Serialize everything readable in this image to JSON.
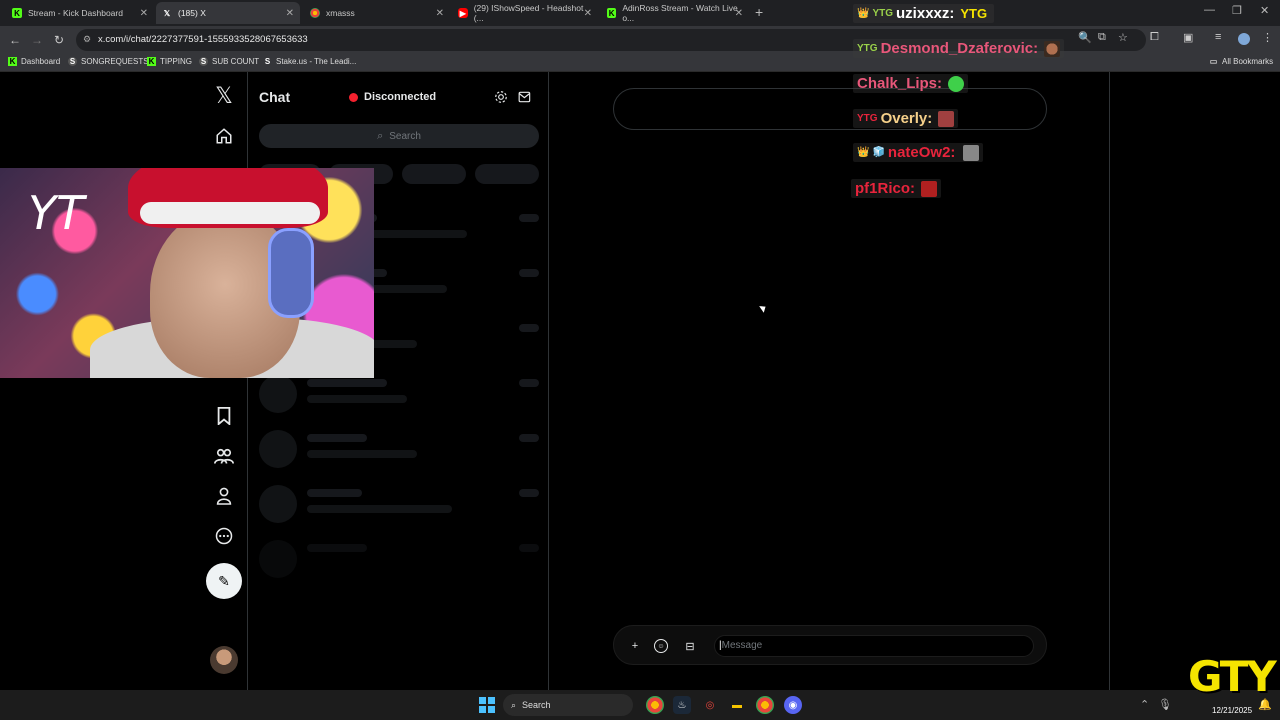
{
  "browser": {
    "tabs": [
      {
        "label": "Stream - Kick Dashboard",
        "icon": "kick-icon",
        "color": "#53fc18"
      },
      {
        "label": "(185) X",
        "icon": "x-icon",
        "color": "#ffffff"
      },
      {
        "label": "xmasss",
        "icon": "chrome-icon",
        "color": "#e8453c"
      },
      {
        "label": "(29) IShowSpeed - Headshot (...",
        "icon": "youtube-icon",
        "color": "#ff0000"
      },
      {
        "label": "AdinRoss Stream - Watch Live o...",
        "icon": "kick-icon",
        "color": "#53fc18"
      }
    ],
    "url": "x.com/i/chat/2227377591-1555933528067653633",
    "bookmarks": [
      {
        "label": "Dashboard",
        "icon": "kick-icon"
      },
      {
        "label": "SONGREQUESTS",
        "icon": "streamelements-icon"
      },
      {
        "label": "TIPPING",
        "icon": "kick-icon"
      },
      {
        "label": "SUB COUNT",
        "icon": "streamelements-icon"
      },
      {
        "label": "Stake.us - The Leadi...",
        "icon": "stake-icon"
      }
    ],
    "all_bookmarks": "All Bookmarks"
  },
  "xchat": {
    "title": "Chat",
    "status": "Disconnected",
    "status_color": "#f4212e",
    "search_placeholder": "Search",
    "message_placeholder": "Message"
  },
  "overlay_chat": [
    {
      "name": "uzixxxz:",
      "color": "#ffffff",
      "badges": "👑YTG",
      "emote": "YTG"
    },
    {
      "name": "Desmond_Dzaferovic:",
      "color": "#e8577a",
      "badges": "YTG",
      "emote": "face"
    },
    {
      "name": "Chalk_Lips:",
      "color": "#e8577a",
      "badges": "",
      "emote": "green"
    },
    {
      "name": "Overly:",
      "color": "#f5d08a",
      "badges": "YTG",
      "emote": "red"
    },
    {
      "name": "nateOw2:",
      "color": "#e8243c",
      "badges": "👑🧊",
      "emote": "photo"
    },
    {
      "name": "pf1Rico:",
      "color": "#e8243c",
      "badges": "",
      "emote": "red"
    }
  ],
  "taskbar": {
    "search": "Search",
    "date": "12/21/2025"
  },
  "watermark": "GTY"
}
